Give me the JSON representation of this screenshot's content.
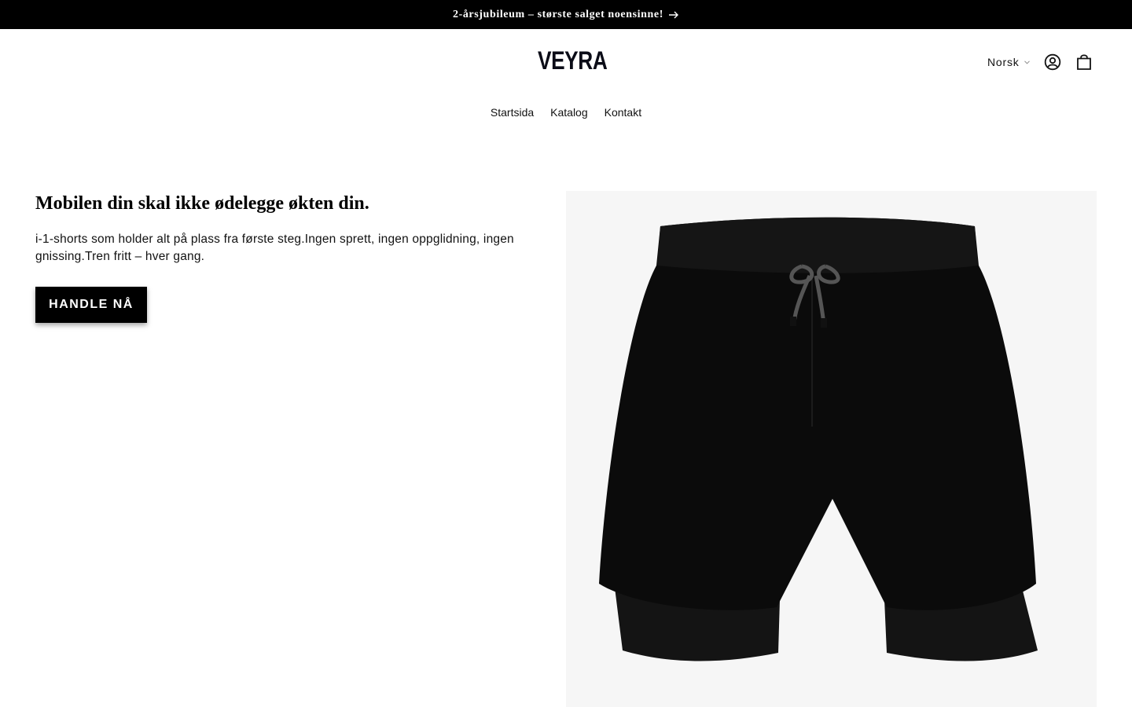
{
  "announcement": {
    "text": "2-årsjubileum – største salget noensinne!",
    "arrow_icon": "arrow-right-icon"
  },
  "header": {
    "logo": "VEYRA",
    "language": "Norsk",
    "icons": {
      "account": "account-icon",
      "cart": "cart-icon",
      "language_chevron": "chevron-down-icon"
    }
  },
  "nav": {
    "items": [
      "Startsida",
      "Katalog",
      "Kontakt"
    ]
  },
  "hero": {
    "title": "Mobilen din skal ikke ødelegge økten din.",
    "text": "i-1-shorts som holder alt på plass fra første steg.Ingen sprett, ingen oppglidning, ingen gnissing.Tren fritt – hver gang.",
    "cta": "HANDLE NÅ",
    "image": "black-2-in-1-shorts-image"
  },
  "colors": {
    "announcement_bg": "#000000",
    "button_bg": "#000000",
    "text": "#121212",
    "media_bg": "#f6f6f6"
  }
}
